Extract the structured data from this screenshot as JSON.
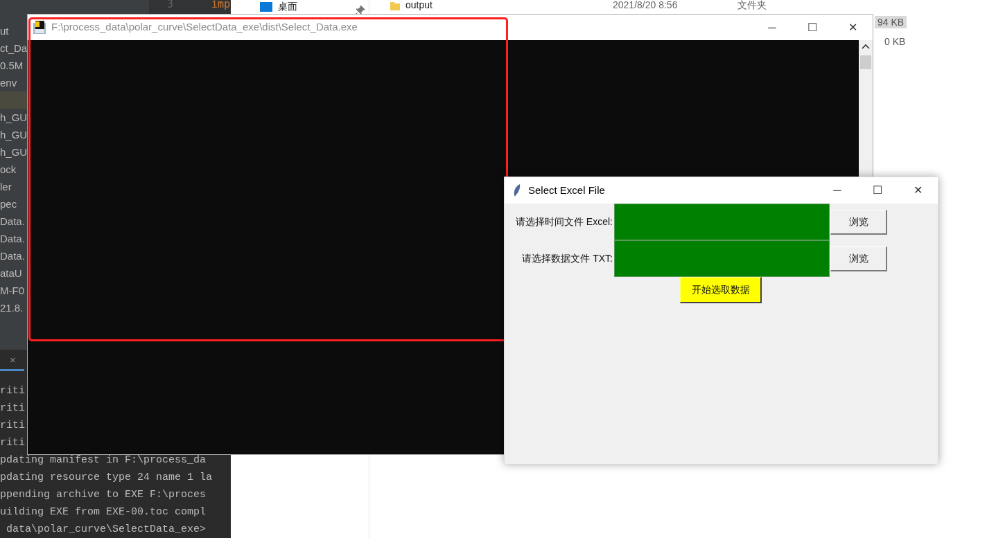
{
  "ide": {
    "project_tree": [
      {
        "label": "ut",
        "selected": false
      },
      {
        "label": "ct_Da",
        "selected": false
      },
      {
        "label": "0.5M",
        "selected": false
      },
      {
        "label": "env",
        "selected": false
      },
      {
        "selected": true
      },
      {
        "label": "h_GU",
        "selected": false
      },
      {
        "label": "h_GU",
        "selected": false
      },
      {
        "label": "h_GU",
        "selected": false
      },
      {
        "label": "ock",
        "selected": false
      },
      {
        "label": "ler",
        "selected": false
      },
      {
        "label": "pec",
        "selected": false
      },
      {
        "label": "Data.",
        "selected": false
      },
      {
        "label": "Data.",
        "selected": false
      },
      {
        "label": "Data.",
        "selected": false
      },
      {
        "label": "ataU",
        "selected": false
      },
      {
        "label": "M-F0",
        "selected": false
      },
      {
        "label": "21.8.",
        "selected": false
      }
    ],
    "editor": {
      "line_number": "3",
      "code": "imp"
    },
    "terminal": {
      "tab_close": "×",
      "lines": [
        {
          "text": "riti"
        },
        {
          "text": "riti"
        },
        {
          "text": "riti"
        },
        {
          "text": "riti"
        },
        {
          "text": "pdating manifest in F:\\process_da"
        },
        {
          "text": "pdating resource type 24 name 1 la"
        },
        {
          "text": "ppending archive to EXE F:\\proces"
        },
        {
          "text": "uilding EXE from EXE-00.toc compl"
        },
        {
          "text": " data\\polar_curve\\SelectData_exe>"
        }
      ]
    }
  },
  "explorer": {
    "nav_items": [
      {
        "label": "桌面",
        "pinned": true
      }
    ],
    "files": [
      {
        "name": "output",
        "date": "2021/8/20 8:56",
        "type": "文件夹"
      }
    ],
    "sizes": [
      {
        "text": "94 KB",
        "selected": true
      },
      {
        "text": "0 KB",
        "selected": false
      }
    ]
  },
  "console_window": {
    "title": "F:\\process_data\\polar_curve\\SelectData_exe\\dist\\Select_Data.exe",
    "controls": [
      "─",
      "☐",
      "✕"
    ]
  },
  "tk_window": {
    "title": "Select Excel File",
    "controls": [
      "─",
      "☐",
      "✕"
    ],
    "rows": [
      {
        "label": "请选择时间文件 Excel:",
        "button": "浏览"
      },
      {
        "label": "请选择数据文件 TXT:",
        "button": "浏览"
      }
    ],
    "start_button": "开始选取数据"
  }
}
